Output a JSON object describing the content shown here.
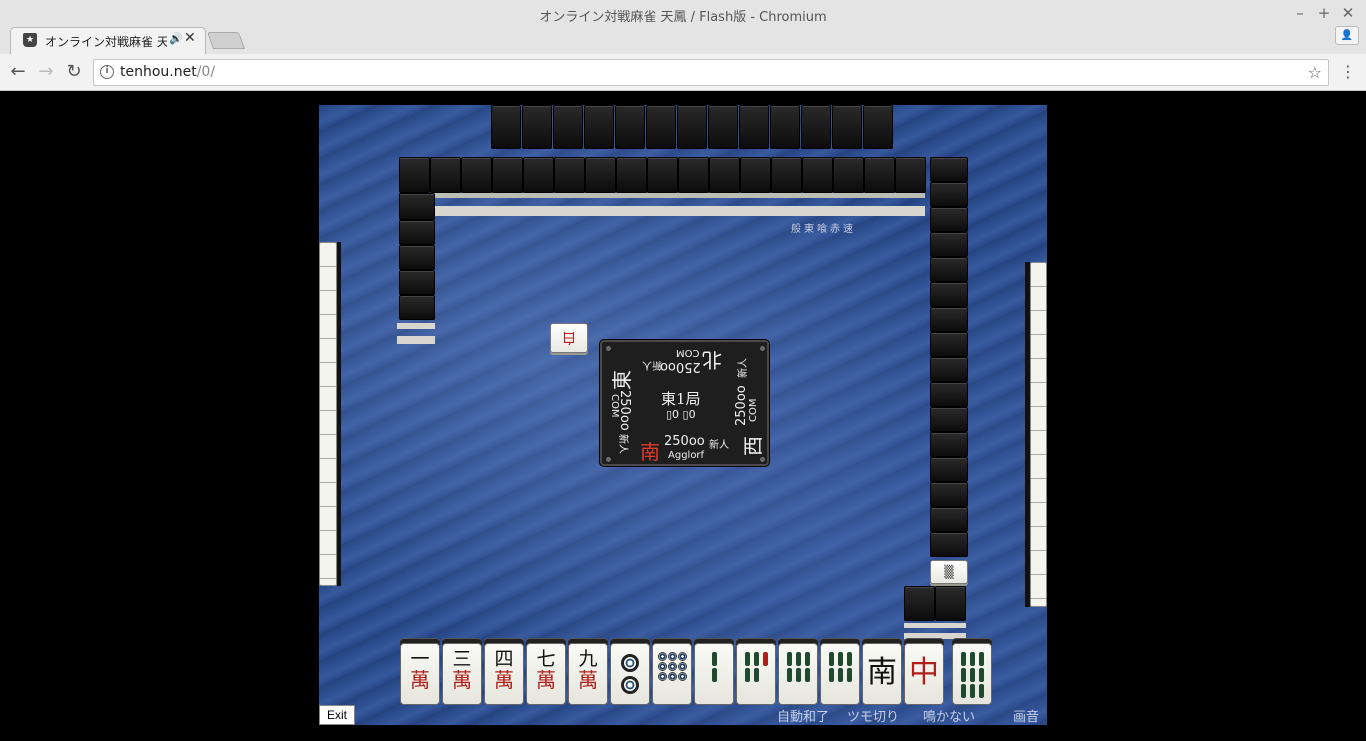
{
  "window": {
    "title": "オンライン対戦麻雀 天鳳 / Flash版 - Chromium",
    "minimize": "–",
    "maximize": "+",
    "close": "✕"
  },
  "tab": {
    "title": "オンライン対戦麻雀 天",
    "audio": "🔊",
    "close": "✕"
  },
  "toolbar": {
    "back": "←",
    "forward": "→",
    "reload": "↻",
    "url_host": "tenhou.net",
    "url_path": "/0/",
    "star": "☆",
    "menu": "⋮",
    "info": "i",
    "profile": "👤"
  },
  "game": {
    "rules": "般東喰赤速",
    "round": "東1局",
    "honba": "▯0 ▯0",
    "players": {
      "self": {
        "wind": "南",
        "score": "250oo",
        "rank": "新人",
        "name": "Agglorf"
      },
      "right": {
        "wind": "西",
        "score": "250oo",
        "rank": "新人",
        "name": "COM"
      },
      "top": {
        "wind": "北",
        "score": "250oo",
        "rank": "新人",
        "name": "COM"
      },
      "left": {
        "wind": "東",
        "score": "250oo",
        "rank": "新人",
        "name": "COM"
      }
    },
    "dora_indicator": "白",
    "hand": [
      {
        "top": "一",
        "bot": "萬"
      },
      {
        "top": "三",
        "bot": "萬"
      },
      {
        "top": "四",
        "bot": "萬"
      },
      {
        "top": "七",
        "bot": "萬"
      },
      {
        "top": "九",
        "bot": "萬"
      },
      {
        "pin": 2
      },
      {
        "pin": 8
      },
      {
        "sou": 2
      },
      {
        "sou": 5
      },
      {
        "sou": 6
      },
      {
        "sou": 6
      },
      {
        "honor": "南",
        "color": "#111"
      },
      {
        "honor": "中",
        "color": "#b0201a"
      },
      {
        "sou": 9
      }
    ],
    "options": {
      "auto_win": "自動和了",
      "tsumogiri": "ツモ切り",
      "no_call": "鳴かない",
      "sound": "画音"
    },
    "exit_label": "Exit"
  }
}
